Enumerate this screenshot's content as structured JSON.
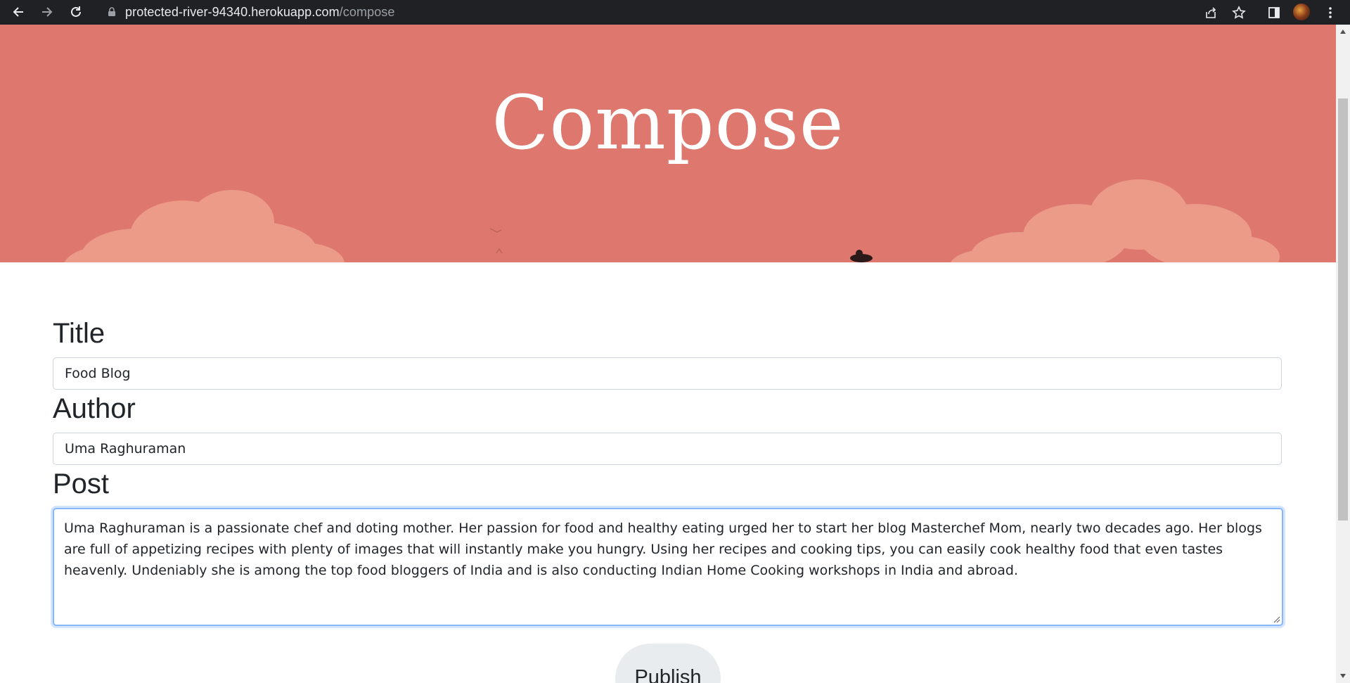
{
  "browser": {
    "url_host": "protected-river-94340.herokuapp.com",
    "url_path": "/compose"
  },
  "hero": {
    "title": "Compose",
    "background_color": "#de786e"
  },
  "form": {
    "title_label": "Title",
    "title_value": "Food Blog",
    "author_label": "Author",
    "author_value": "Uma Raghuraman",
    "post_label": "Post",
    "post_value": "Uma Raghuraman is a passionate chef and doting mother. Her passion for food and healthy eating urged her to start her blog Masterchef Mom, nearly two decades ago. Her blogs are full of appetizing recipes with plenty of images that will instantly make you hungry. Using her recipes and cooking tips, you can easily cook healthy food that even tastes heavenly. Undeniably she is among the top food bloggers of India and is also conducting Indian Home Cooking workshops in India and abroad.",
    "publish_label": "Publish"
  },
  "icons": {
    "back": "back-arrow-icon",
    "forward": "forward-arrow-icon",
    "reload": "reload-icon",
    "lock": "lock-icon",
    "share": "share-icon",
    "bookmark": "star-icon",
    "sidepanel": "side-panel-icon",
    "menu": "kebab-menu-icon"
  }
}
